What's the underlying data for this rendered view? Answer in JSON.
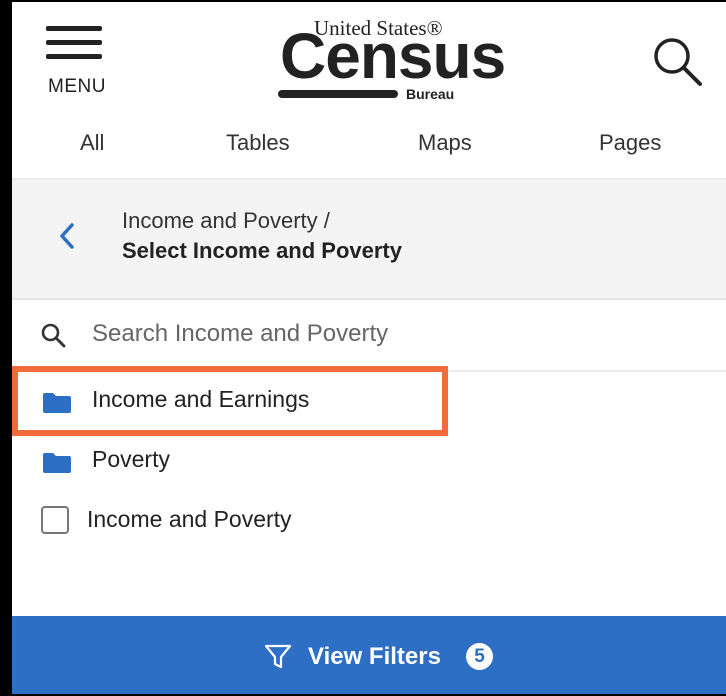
{
  "header": {
    "menu_label": "MENU",
    "logo": {
      "top_text": "United States®",
      "main_text": "Census",
      "sub_text": "Bureau"
    },
    "tabs": [
      {
        "label": "All"
      },
      {
        "label": "Tables"
      },
      {
        "label": "Maps"
      },
      {
        "label": "Pages"
      }
    ]
  },
  "breadcrumb": {
    "parent": "Income and Poverty /",
    "current": "Select Income and Poverty"
  },
  "search": {
    "placeholder": "Search Income and Poverty",
    "value": ""
  },
  "list": {
    "items": [
      {
        "label": "Income and Earnings",
        "icon": "folder-icon",
        "highlighted": true
      },
      {
        "label": "Poverty",
        "icon": "folder-icon"
      },
      {
        "label": "Income and Poverty",
        "icon": "checkbox",
        "checked": false
      }
    ]
  },
  "footer": {
    "label": "View Filters",
    "count": "5"
  },
  "colors": {
    "accent": "#2c6fc4",
    "highlight": "#f26b3a"
  }
}
